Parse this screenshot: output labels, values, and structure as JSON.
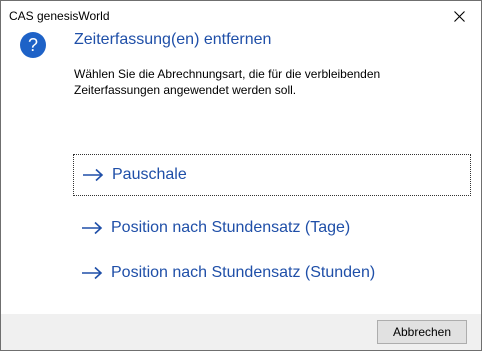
{
  "window": {
    "title": "CAS genesisWorld",
    "close_icon": "close-icon"
  },
  "dialog": {
    "icon": "question-icon",
    "icon_color": "#1e62c7",
    "heading": "Zeiterfassung(en) entfernen",
    "description": "Wählen Sie die Abrechnungsart, die für die verbleibenden Zeiterfassungen angewendet werden soll.",
    "accent_color": "#1f4fa8",
    "options": [
      {
        "label": "Pauschale",
        "icon": "arrow-right-icon",
        "focused": true
      },
      {
        "label": "Position nach Stundensatz (Tage)",
        "icon": "arrow-right-icon",
        "focused": false
      },
      {
        "label": "Position nach Stundensatz (Stunden)",
        "icon": "arrow-right-icon",
        "focused": false
      }
    ]
  },
  "footer": {
    "cancel_label": "Abbrechen"
  }
}
